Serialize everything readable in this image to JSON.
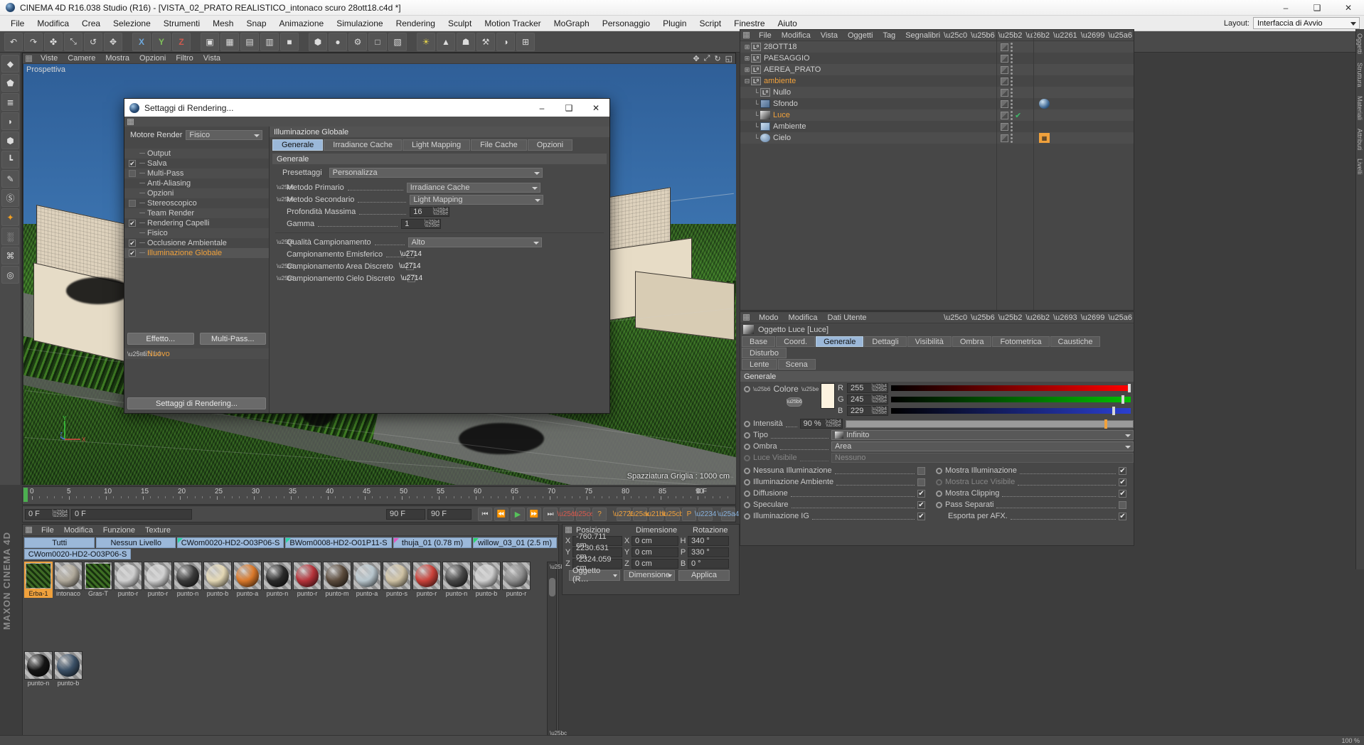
{
  "window": {
    "title": "CINEMA 4D R16.038 Studio (R16) - [VISTA_02_PRATO REALISTICO_intonaco scuro 28ott18.c4d *]",
    "minimize": "–",
    "maximize": "❑",
    "close": "✕"
  },
  "menubar": {
    "items": [
      "File",
      "Modifica",
      "Crea",
      "Selezione",
      "Strumenti",
      "Mesh",
      "Snap",
      "Animazione",
      "Simulazione",
      "Rendering",
      "Sculpt",
      "Motion Tracker",
      "MoGraph",
      "Personaggio",
      "Plugin",
      "Script",
      "Finestre",
      "Aiuto"
    ],
    "layout_label": "Layout:",
    "layout_value": "Interfaccia di Avvio"
  },
  "toolbar": {
    "buttons": [
      "↶",
      "↷",
      "✤",
      "⤡",
      "↺",
      "✥",
      "X",
      "Y",
      "Z",
      "▣",
      "▦",
      "▤",
      "▥",
      "■",
      "⬢",
      "●",
      "⚙",
      "□",
      "▧",
      "☀",
      "▲",
      "☗",
      "⚒",
      "◑",
      "⊞"
    ]
  },
  "left_tools": {
    "buttons": [
      "◆",
      "⬟",
      "≣",
      "◗",
      "⬢",
      "┗",
      "✎",
      "Ⓢ",
      "✦",
      "░",
      "⌘",
      "◎"
    ]
  },
  "viewport": {
    "menu": [
      "Viste",
      "Camere",
      "Mostra",
      "Opzioni",
      "Filtro",
      "Vista"
    ],
    "icons": [
      "✥",
      "⤢",
      "↻",
      "◱"
    ],
    "label": "Prospettiva",
    "grid_label": "Spazziatura Griglia : 1000 cm"
  },
  "render_settings": {
    "title": "Settaggi di Rendering...",
    "engine_label": "Motore Render",
    "engine_value": "Fisico",
    "tree": [
      {
        "label": "Output",
        "check": "none"
      },
      {
        "label": "Salva",
        "check": "on"
      },
      {
        "label": "Multi-Pass",
        "check": "off"
      },
      {
        "label": "Anti-Aliasing",
        "check": "none"
      },
      {
        "label": "Opzioni",
        "check": "none"
      },
      {
        "label": "Stereoscopico",
        "check": "off"
      },
      {
        "label": "Team Render",
        "check": "none"
      },
      {
        "label": "Rendering Capelli",
        "check": "on"
      },
      {
        "label": "Fisico",
        "check": "none"
      },
      {
        "label": "Occlusione Ambientale",
        "check": "on"
      },
      {
        "label": "Illuminazione Globale",
        "check": "on",
        "selected": true
      }
    ],
    "effect_button": "Effetto...",
    "multipass_button": "Multi-Pass...",
    "new_item": "Nuovo",
    "bottom_button": "Settaggi di Rendering...",
    "section_title": "Illuminazione Globale",
    "tabs": [
      "Generale",
      "Irradiance Cache",
      "Light Mapping",
      "File Cache",
      "Opzioni"
    ],
    "active_tab": "Generale",
    "sub_title": "Generale",
    "fields": {
      "presets_label": "Presettaggi",
      "presets_value": "Personalizza",
      "primary_label": "Metodo Primario",
      "primary_value": "Irradiance Cache",
      "secondary_label": "Metodo Secondario",
      "secondary_value": "Light Mapping",
      "depth_label": "Profondità Massima",
      "depth_value": "16",
      "gamma_label": "Gamma",
      "gamma_value": "1",
      "quality_label": "Qualità Campionamento",
      "quality_value": "Alto",
      "hemi_label": "Campionamento Emisferico",
      "area_label": "Campionamento Area Discreto",
      "sky_label": "Campionamento Cielo Discreto"
    }
  },
  "object_manager": {
    "menu": [
      "File",
      "Modifica",
      "Vista",
      "Oggetti",
      "Tag",
      "Segnalibri"
    ],
    "items": [
      {
        "label": "28OTT18",
        "icon": "null-icon",
        "depth": 0,
        "twirl": "⊞",
        "selected": false,
        "tag": ""
      },
      {
        "label": "PAESAGGIO",
        "icon": "null-icon",
        "depth": 0,
        "twirl": "⊞",
        "selected": false,
        "tag": ""
      },
      {
        "label": "AEREA_PRATO",
        "icon": "null-icon",
        "depth": 0,
        "twirl": "⊞",
        "selected": false,
        "tag": ""
      },
      {
        "label": "ambiente",
        "icon": "null-icon",
        "depth": 0,
        "twirl": "⊟",
        "selected": true,
        "tag": ""
      },
      {
        "label": "Nullo",
        "icon": "null-icon",
        "depth": 1,
        "twirl": "",
        "selected": false,
        "tag": ""
      },
      {
        "label": "Sfondo",
        "icon": "background-icon",
        "depth": 1,
        "twirl": "",
        "selected": false,
        "tag": "sphere"
      },
      {
        "label": "Luce",
        "icon": "light-icon",
        "depth": 1,
        "twirl": "",
        "selected": true,
        "tag": "",
        "check": true
      },
      {
        "label": "Ambiente",
        "icon": "environment-icon",
        "depth": 1,
        "twirl": "",
        "selected": false,
        "tag": ""
      },
      {
        "label": "Cielo",
        "icon": "sky-icon",
        "depth": 1,
        "twirl": "",
        "selected": false,
        "tag": "sky"
      }
    ]
  },
  "attribute_manager": {
    "menu": [
      "Modo",
      "Modifica",
      "Dati Utente"
    ],
    "object_title": "Oggetto Luce [Luce]",
    "tabs_row1": [
      "Base",
      "Coord.",
      "Generale",
      "Dettagli",
      "Visibilità",
      "Ombra",
      "Fotometrica",
      "Caustiche",
      "Disturbo"
    ],
    "tabs_row2": [
      "Lente",
      "Scena"
    ],
    "active_tab": "Generale",
    "section": "Generale",
    "color_label": "Colore",
    "color_swatch": "#fdf3e0",
    "color_r_label": "R",
    "color_r": "255",
    "color_g_label": "G",
    "color_g": "245",
    "color_b_label": "B",
    "color_b": "229",
    "intensity_label": "Intensità",
    "intensity_value": "90 %",
    "type_label": "Tipo",
    "type_value": "Infinito",
    "shadow_label": "Ombra",
    "shadow_value": "Area",
    "visible_light_label": "Luce Visibile",
    "visible_light_value": "Nessuno",
    "left_options": [
      {
        "label": "Nessuna Illuminazione",
        "state": "off"
      },
      {
        "label": "Illuminazione Ambiente",
        "state": "off"
      },
      {
        "label": "Diffusione",
        "state": "on"
      },
      {
        "label": "Speculare",
        "state": "on"
      },
      {
        "label": "Illuminazione IG",
        "state": "on"
      }
    ],
    "right_options": [
      {
        "label": "Mostra Illuminazione",
        "state": "on",
        "dim": false
      },
      {
        "label": "Mostra Luce Visibile",
        "state": "on",
        "dim": true
      },
      {
        "label": "Mostra Clipping",
        "state": "on",
        "dim": false
      },
      {
        "label": "Pass Separati",
        "state": "off",
        "dim": false
      },
      {
        "label": "Esporta per AFX.",
        "state": "on",
        "dim": false
      }
    ]
  },
  "timeline": {
    "ticks": [
      "0",
      "5",
      "10",
      "15",
      "20",
      "25",
      "30",
      "35",
      "40",
      "45",
      "50",
      "55",
      "60",
      "65",
      "70",
      "75",
      "80",
      "85",
      "90"
    ],
    "current_right": "0 F",
    "field_left": "0 F",
    "field_mid": "0 F",
    "field_end": "90 F",
    "field_end2": "90 F",
    "buttons": [
      "⏮",
      "⏪",
      "▶",
      "⏩",
      "⏭"
    ]
  },
  "material_manager": {
    "menu": [
      "File",
      "Modifica",
      "Funzione",
      "Texture"
    ],
    "chips": [
      "Tutti",
      "Nessun Livello",
      "CWom0020-HD2-O03P06-S",
      "BWom0008-HD2-O01P11-S",
      "thuja_01 (0.78 m)",
      "willow_03_01 (2.5 m)"
    ],
    "selected_chip_row2": "CWom0020-HD2-O03P06-S",
    "materials": [
      {
        "name": "Erba-1",
        "color": "#3e6a25",
        "selected": true
      },
      {
        "name": "intonaco",
        "color": "#b0a99b",
        "selected": false
      },
      {
        "name": "Gras-T",
        "color": "#3d6e24",
        "selected": false
      },
      {
        "name": "punto-r",
        "color": "#cfcfcf",
        "selected": false
      },
      {
        "name": "punto-r",
        "color": "#d2d2d2",
        "selected": false
      },
      {
        "name": "punto-n",
        "color": "#3a3a3a",
        "selected": false
      },
      {
        "name": "punto-b",
        "color": "#e3d7b4",
        "selected": false
      },
      {
        "name": "punto-a",
        "color": "#d9782a",
        "selected": false
      },
      {
        "name": "punto-n",
        "color": "#2a2a2a",
        "selected": false
      },
      {
        "name": "punto-r",
        "color": "#b5333a",
        "selected": false
      },
      {
        "name": "punto-m",
        "color": "#5b4b3c",
        "selected": false
      },
      {
        "name": "punto-a",
        "color": "#b8c6cd",
        "selected": false
      },
      {
        "name": "punto-s",
        "color": "#cfc2a4",
        "selected": false
      },
      {
        "name": "punto-r",
        "color": "#c9423a",
        "selected": false
      },
      {
        "name": "punto-n",
        "color": "#474747",
        "selected": false
      },
      {
        "name": "punto-b",
        "color": "#cfcfcf",
        "selected": false
      },
      {
        "name": "punto-r",
        "color": "#8d8d8d",
        "selected": false
      },
      {
        "name": "punto-n",
        "color": "#151515",
        "selected": false
      },
      {
        "name": "punto-b",
        "color": "#3b5066",
        "selected": false
      }
    ]
  },
  "coordinates": {
    "headers": [
      "Posizione",
      "Dimensione",
      "Rotazione"
    ],
    "rows": [
      {
        "l1": "X",
        "v1": "-760.711 cm",
        "l2": "X",
        "v2": "0 cm",
        "l3": "H",
        "v3": "340 °"
      },
      {
        "l1": "Y",
        "v1": "2230.631 cm",
        "l2": "Y",
        "v2": "0 cm",
        "l3": "P",
        "v3": "330 °"
      },
      {
        "l1": "Z",
        "v1": "-2324.059 cm",
        "l2": "Z",
        "v2": "0 cm",
        "l3": "B",
        "v3": "0 °"
      }
    ],
    "mode_button": "Oggetto (R…",
    "size_button": "Dimensione",
    "apply_button": "Applica"
  },
  "right_tabs": [
    "Oggetti",
    "Struttura",
    "Materiali",
    "Attributi",
    "Livelli"
  ],
  "brand": "MAXON CINEMA 4D",
  "status": {
    "zoom": "100 %"
  }
}
